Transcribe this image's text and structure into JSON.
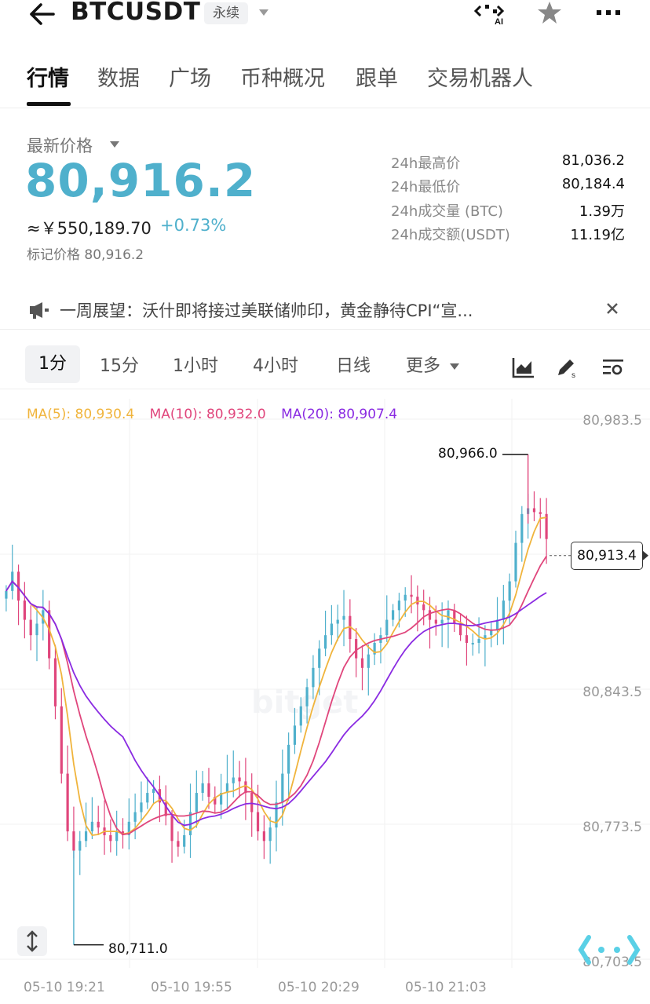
{
  "header": {
    "symbol": "BTCUSDT",
    "contract_tag": "永续"
  },
  "tabs": [
    {
      "label": "行情",
      "active": true
    },
    {
      "label": "数据",
      "active": false
    },
    {
      "label": "广场",
      "active": false
    },
    {
      "label": "币种概况",
      "active": false
    },
    {
      "label": "跟单",
      "active": false
    },
    {
      "label": "交易机器人",
      "active": false
    }
  ],
  "price": {
    "label": "最新价格",
    "last": "80,916.2",
    "cny": "≈￥550,189.70",
    "change": "+0.73%",
    "mark": "标记价格 80,916.2",
    "accent_color": "#4fb0cc"
  },
  "stats": [
    {
      "label": "24h最高价",
      "value": "81,036.2"
    },
    {
      "label": "24h最低价",
      "value": "80,184.4"
    },
    {
      "label": "24h成交量 (BTC)",
      "value": "1.39万"
    },
    {
      "label": "24h成交额(USDT)",
      "value": "11.19亿"
    }
  ],
  "news": {
    "text": "一周展望：沃什即将接过美联储帅印，黄金静待CPI“宣..."
  },
  "intervals": {
    "items": [
      "1分",
      "15分",
      "1小时",
      "4小时",
      "日线",
      "更多"
    ],
    "active": "1分"
  },
  "chart": {
    "ma_legend": {
      "ma5": "MA(5): 80,930.4",
      "ma10": "MA(10): 80,932.0",
      "ma20": "MA(20): 80,907.4"
    },
    "y_labels": [
      "80,983.5",
      "80,843.5",
      "80,773.5",
      "80,703.5"
    ],
    "x_labels": [
      "05-10 19:21",
      "05-10 19:55",
      "05-10 20:29",
      "05-10 21:03"
    ],
    "high_label": "80,966.0",
    "low_label": "80,711.0",
    "last_label": "80,913.4",
    "watermark": "bitget",
    "colors": {
      "up": "#4fb0cc",
      "down": "#e0467c",
      "ma5": "#f0b43c",
      "ma10": "#e0467c",
      "ma20": "#8a2be2"
    }
  },
  "chart_data": {
    "type": "candlestick",
    "ylim": [
      80703.5,
      80983.5
    ],
    "x_labels": [
      "05-10 19:21",
      "05-10 19:55",
      "05-10 20:29",
      "05-10 21:03"
    ],
    "ma_series": [
      {
        "name": "MA(5)",
        "last": 80930.4
      },
      {
        "name": "MA(10)",
        "last": 80932.0
      },
      {
        "name": "MA(20)",
        "last": 80907.4
      }
    ],
    "close": [
      80895,
      80905,
      80890,
      80880,
      80872,
      80878,
      80885,
      80860,
      80835,
      80800,
      80770,
      80760,
      80765,
      80770,
      80775,
      80772,
      80768,
      80765,
      80770,
      80768,
      80775,
      80780,
      80785,
      80790,
      80792,
      80785,
      80778,
      80765,
      80762,
      80768,
      80780,
      80790,
      80795,
      80788,
      80784,
      80790,
      80795,
      80798,
      80796,
      80790,
      80780,
      80770,
      80765,
      80772,
      80785,
      80800,
      80815,
      80825,
      80835,
      80845,
      80855,
      80865,
      80872,
      80878,
      80880,
      80882,
      80870,
      80860,
      80855,
      80862,
      80868,
      80872,
      80880,
      80885,
      80890,
      80893,
      80892,
      80888,
      80885,
      80880,
      80878,
      80880,
      80885,
      80878,
      80872,
      80868,
      80868,
      80870,
      80872,
      80875,
      80880,
      80890,
      80900,
      80920,
      80935,
      80938,
      80936,
      80935,
      80922
    ],
    "last_price": 80913.4,
    "high_marker": 80966.0,
    "low_marker": 80711.0
  }
}
